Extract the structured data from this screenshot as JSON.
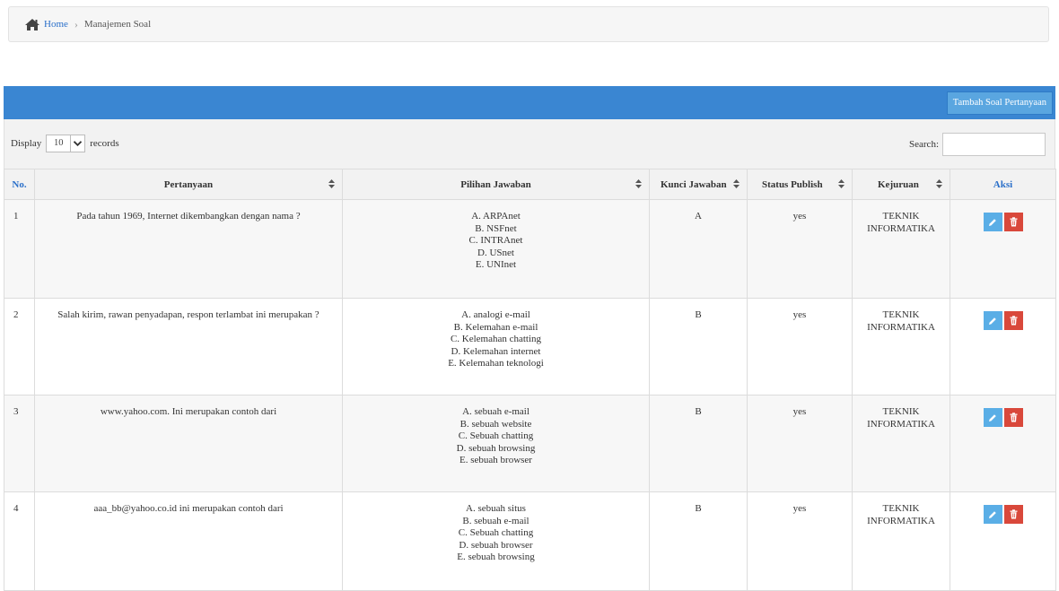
{
  "breadcrumb": {
    "home": "Home",
    "separator": "›",
    "current": "Manajemen Soal"
  },
  "panel": {
    "add_button": "Tambah Soal Pertanyaan"
  },
  "controls": {
    "display_label": "Display",
    "page_length": "10",
    "records_label": "records",
    "search_label": "Search:",
    "search_value": ""
  },
  "table": {
    "headers": {
      "no": "No.",
      "pertanyaan": "Pertanyaan",
      "pilihan": "Pilihan Jawaban",
      "kunci": "Kunci Jawaban",
      "status": "Status Publish",
      "kejuruan": "Kejuruan",
      "aksi": "Aksi"
    },
    "rows": [
      {
        "no": "1",
        "pertanyaan": "Pada tahun 1969, Internet dikembangkan dengan nama ?",
        "pilihan": [
          "A. ARPAnet",
          "B. NSFnet",
          "C. INTRAnet",
          "D. USnet",
          "E. UNInet"
        ],
        "kunci": "A",
        "status": "yes",
        "kejuruan": "TEKNIK INFORMATIKA"
      },
      {
        "no": "2",
        "pertanyaan": "Salah kirim, rawan penyadapan, respon terlambat ini merupakan ?",
        "pilihan": [
          "A. analogi e-mail",
          "B. Kelemahan e-mail",
          "C. Kelemahan chatting",
          "D. Kelemahan internet",
          "E. Kelemahan teknologi"
        ],
        "kunci": "B",
        "status": "yes",
        "kejuruan": "TEKNIK INFORMATIKA"
      },
      {
        "no": "3",
        "pertanyaan": "www.yahoo.com. Ini merupakan contoh dari",
        "pilihan": [
          "A. sebuah e-mail",
          "B. sebuah website",
          "C. Sebuah chatting",
          "D. sebuah browsing",
          "E. sebuah browser"
        ],
        "kunci": "B",
        "status": "yes",
        "kejuruan": "TEKNIK INFORMATIKA"
      },
      {
        "no": "4",
        "pertanyaan": "aaa_bb@yahoo.co.id ini merupakan contoh dari",
        "pilihan": [
          "A. sebuah situs",
          "B. sebuah e-mail",
          "C. Sebuah chatting",
          "D. sebuah browser",
          "E. sebuah browsing"
        ],
        "kunci": "B",
        "status": "yes",
        "kejuruan": "TEKNIK INFORMATIKA"
      }
    ]
  },
  "icons": {
    "home": "home-icon",
    "sort": "sort-icon",
    "caret": "chevron-down-icon",
    "edit": "pencil-icon",
    "delete": "trash-icon"
  },
  "colors": {
    "panel_header": "#3a86d2",
    "add_button": "#5aa6e0",
    "edit_button": "#5aaee6",
    "delete_button": "#d9483b",
    "link": "#2a6fc9"
  }
}
